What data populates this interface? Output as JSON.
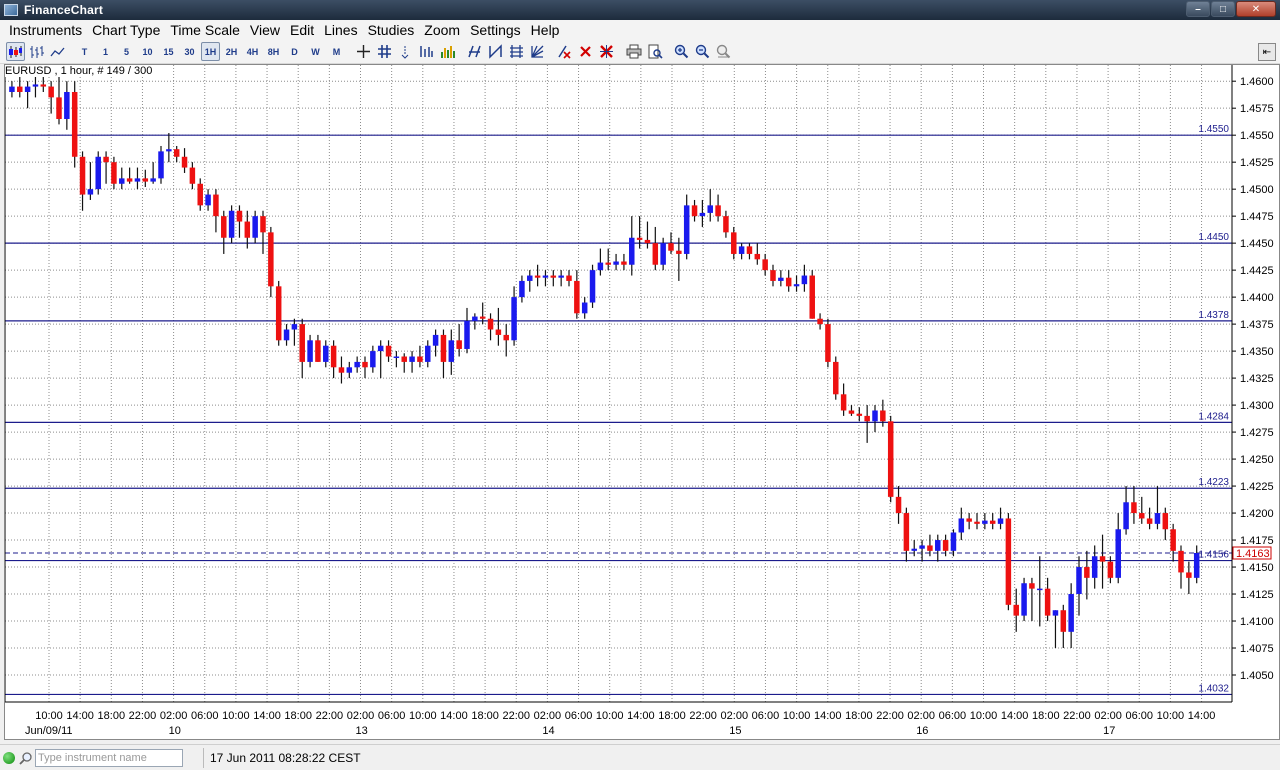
{
  "window": {
    "title": "FinanceChart",
    "min": "0",
    "max": "1",
    "close": "r"
  },
  "menu": [
    "Instruments",
    "Chart Type",
    "Time Scale",
    "View",
    "Edit",
    "Lines",
    "Studies",
    "Zoom",
    "Settings",
    "Help"
  ],
  "toolbar": {
    "timeframes": [
      "T",
      "1",
      "5",
      "10",
      "15",
      "30",
      "1H",
      "2H",
      "4H",
      "8H",
      "D",
      "W",
      "M"
    ],
    "active_timeframe": "1H"
  },
  "chart": {
    "instrument_info": "EURUSD , 1 hour, # 149 / 300",
    "ylim": [
      1.4025,
      1.4615
    ],
    "y_ticks": [
      "1.4600",
      "1.4575",
      "1.4550",
      "1.4525",
      "1.4500",
      "1.4475",
      "1.4450",
      "1.4425",
      "1.4400",
      "1.4375",
      "1.4350",
      "1.4325",
      "1.4300",
      "1.4275",
      "1.4250",
      "1.4225",
      "1.4200",
      "1.4175",
      "1.4150",
      "1.4125",
      "1.4100",
      "1.4075",
      "1.4050"
    ],
    "horizontal_lines": [
      "1.4550",
      "1.4450",
      "1.4378",
      "1.4284",
      "1.4223",
      "1.4156",
      "1.4032"
    ],
    "current_price": "1.4163",
    "x_ticks": [
      "10:00",
      "14:00",
      "18:00",
      "22:00",
      "02:00",
      "06:00",
      "10:00",
      "14:00",
      "18:00",
      "22:00",
      "02:00",
      "06:00",
      "10:00",
      "14:00",
      "18:00",
      "22:00",
      "02:00",
      "06:00",
      "10:00",
      "14:00",
      "18:00",
      "22:00",
      "02:00",
      "06:00",
      "10:00",
      "14:00",
      "18:00",
      "22:00",
      "02:00",
      "06:00",
      "10:00",
      "14:00",
      "18:00",
      "22:00",
      "02:00",
      "06:00",
      "10:00",
      "14:00"
    ],
    "date_labels": [
      "Jun/09/11",
      "10",
      "13",
      "14",
      "15",
      "16",
      "17"
    ],
    "colors": {
      "up": "#1a1aee",
      "down": "#ee1111",
      "level_line": "#1c1c8c",
      "price_box": "#cc0000"
    }
  },
  "chart_data": {
    "type": "candlestick",
    "ohlc": [
      [
        1.459,
        1.46,
        1.4585,
        1.4595
      ],
      [
        1.4595,
        1.4605,
        1.4585,
        1.459
      ],
      [
        1.459,
        1.46,
        1.4575,
        1.4595
      ],
      [
        1.4595,
        1.4605,
        1.4585,
        1.4597
      ],
      [
        1.4597,
        1.4605,
        1.459,
        1.4595
      ],
      [
        1.4595,
        1.46,
        1.457,
        1.4585
      ],
      [
        1.4585,
        1.4605,
        1.456,
        1.4565
      ],
      [
        1.4565,
        1.46,
        1.4555,
        1.459
      ],
      [
        1.459,
        1.46,
        1.452,
        1.453
      ],
      [
        1.453,
        1.4535,
        1.448,
        1.4495
      ],
      [
        1.4495,
        1.4525,
        1.449,
        1.45
      ],
      [
        1.45,
        1.4535,
        1.4495,
        1.453
      ],
      [
        1.453,
        1.4535,
        1.4505,
        1.4525
      ],
      [
        1.4525,
        1.453,
        1.45,
        1.4505
      ],
      [
        1.4505,
        1.452,
        1.45,
        1.451
      ],
      [
        1.451,
        1.452,
        1.4505,
        1.4507
      ],
      [
        1.4507,
        1.452,
        1.45,
        1.451
      ],
      [
        1.451,
        1.4518,
        1.4502,
        1.4507
      ],
      [
        1.4507,
        1.4525,
        1.4505,
        1.451
      ],
      [
        1.451,
        1.454,
        1.4505,
        1.4535
      ],
      [
        1.4535,
        1.4552,
        1.4525,
        1.4537
      ],
      [
        1.4537,
        1.454,
        1.4525,
        1.453
      ],
      [
        1.453,
        1.4538,
        1.4515,
        1.452
      ],
      [
        1.452,
        1.4525,
        1.45,
        1.4505
      ],
      [
        1.4505,
        1.451,
        1.448,
        1.4485
      ],
      [
        1.4485,
        1.45,
        1.448,
        1.4495
      ],
      [
        1.4495,
        1.45,
        1.446,
        1.4475
      ],
      [
        1.4475,
        1.448,
        1.444,
        1.4455
      ],
      [
        1.4455,
        1.4485,
        1.445,
        1.448
      ],
      [
        1.448,
        1.4485,
        1.4455,
        1.447
      ],
      [
        1.447,
        1.448,
        1.4445,
        1.4455
      ],
      [
        1.4455,
        1.448,
        1.445,
        1.4475
      ],
      [
        1.4475,
        1.448,
        1.444,
        1.446
      ],
      [
        1.446,
        1.4465,
        1.44,
        1.441
      ],
      [
        1.441,
        1.4415,
        1.4355,
        1.436
      ],
      [
        1.436,
        1.4375,
        1.4355,
        1.437
      ],
      [
        1.437,
        1.438,
        1.4355,
        1.4375
      ],
      [
        1.4375,
        1.438,
        1.4325,
        1.434
      ],
      [
        1.434,
        1.4365,
        1.4335,
        1.436
      ],
      [
        1.436,
        1.4365,
        1.434,
        1.434
      ],
      [
        1.434,
        1.436,
        1.4335,
        1.4355
      ],
      [
        1.4355,
        1.436,
        1.4325,
        1.4335
      ],
      [
        1.4335,
        1.4345,
        1.432,
        1.433
      ],
      [
        1.433,
        1.434,
        1.4325,
        1.4335
      ],
      [
        1.4335,
        1.4345,
        1.433,
        1.434
      ],
      [
        1.434,
        1.4345,
        1.4325,
        1.4335
      ],
      [
        1.4335,
        1.4355,
        1.433,
        1.435
      ],
      [
        1.435,
        1.436,
        1.4325,
        1.4355
      ],
      [
        1.4355,
        1.436,
        1.434,
        1.4345
      ],
      [
        1.4345,
        1.435,
        1.4335,
        1.4345
      ],
      [
        1.4345,
        1.4348,
        1.433,
        1.434
      ],
      [
        1.434,
        1.435,
        1.433,
        1.4345
      ],
      [
        1.4345,
        1.4355,
        1.4335,
        1.434
      ],
      [
        1.434,
        1.436,
        1.4335,
        1.4355
      ],
      [
        1.4355,
        1.437,
        1.4345,
        1.4365
      ],
      [
        1.4365,
        1.437,
        1.4325,
        1.434
      ],
      [
        1.434,
        1.437,
        1.4328,
        1.436
      ],
      [
        1.436,
        1.4375,
        1.4345,
        1.4352
      ],
      [
        1.4352,
        1.439,
        1.4348,
        1.4378
      ],
      [
        1.4378,
        1.4385,
        1.437,
        1.4382
      ],
      [
        1.4382,
        1.4395,
        1.4375,
        1.438
      ],
      [
        1.438,
        1.4385,
        1.436,
        1.437
      ],
      [
        1.437,
        1.439,
        1.4355,
        1.4365
      ],
      [
        1.4365,
        1.4375,
        1.4345,
        1.436
      ],
      [
        1.436,
        1.441,
        1.4355,
        1.44
      ],
      [
        1.44,
        1.442,
        1.4395,
        1.4415
      ],
      [
        1.4415,
        1.4425,
        1.4405,
        1.442
      ],
      [
        1.442,
        1.443,
        1.441,
        1.4418
      ],
      [
        1.4418,
        1.4425,
        1.441,
        1.442
      ],
      [
        1.442,
        1.4425,
        1.441,
        1.4418
      ],
      [
        1.4418,
        1.4425,
        1.441,
        1.442
      ],
      [
        1.442,
        1.4425,
        1.441,
        1.4415
      ],
      [
        1.4415,
        1.4425,
        1.438,
        1.4385
      ],
      [
        1.4385,
        1.44,
        1.438,
        1.4395
      ],
      [
        1.4395,
        1.443,
        1.439,
        1.4425
      ],
      [
        1.4425,
        1.4445,
        1.442,
        1.4432
      ],
      [
        1.4432,
        1.4445,
        1.4425,
        1.443
      ],
      [
        1.443,
        1.444,
        1.4425,
        1.4433
      ],
      [
        1.4433,
        1.444,
        1.4425,
        1.443
      ],
      [
        1.443,
        1.4475,
        1.442,
        1.4455
      ],
      [
        1.4455,
        1.4475,
        1.4445,
        1.4453
      ],
      [
        1.4453,
        1.447,
        1.4445,
        1.445
      ],
      [
        1.445,
        1.4465,
        1.4425,
        1.443
      ],
      [
        1.443,
        1.4455,
        1.4425,
        1.445
      ],
      [
        1.445,
        1.446,
        1.444,
        1.4443
      ],
      [
        1.4443,
        1.4455,
        1.4415,
        1.444
      ],
      [
        1.444,
        1.4495,
        1.4435,
        1.4485
      ],
      [
        1.4485,
        1.449,
        1.447,
        1.4475
      ],
      [
        1.4475,
        1.449,
        1.4465,
        1.4478
      ],
      [
        1.4478,
        1.45,
        1.447,
        1.4485
      ],
      [
        1.4485,
        1.4495,
        1.447,
        1.4475
      ],
      [
        1.4475,
        1.448,
        1.4455,
        1.446
      ],
      [
        1.446,
        1.4465,
        1.4435,
        1.444
      ],
      [
        1.444,
        1.445,
        1.4435,
        1.4447
      ],
      [
        1.4447,
        1.445,
        1.4435,
        1.444
      ],
      [
        1.444,
        1.445,
        1.443,
        1.4435
      ],
      [
        1.4435,
        1.444,
        1.442,
        1.4425
      ],
      [
        1.4425,
        1.443,
        1.441,
        1.4415
      ],
      [
        1.4415,
        1.4425,
        1.441,
        1.4418
      ],
      [
        1.4418,
        1.4425,
        1.4405,
        1.441
      ],
      [
        1.441,
        1.442,
        1.4405,
        1.4412
      ],
      [
        1.4412,
        1.443,
        1.4405,
        1.442
      ],
      [
        1.442,
        1.4425,
        1.438,
        1.438
      ],
      [
        1.438,
        1.4385,
        1.437,
        1.4375
      ],
      [
        1.4375,
        1.438,
        1.4335,
        1.434
      ],
      [
        1.434,
        1.4345,
        1.4305,
        1.431
      ],
      [
        1.431,
        1.432,
        1.429,
        1.4295
      ],
      [
        1.4295,
        1.43,
        1.429,
        1.4292
      ],
      [
        1.4292,
        1.4298,
        1.4285,
        1.429
      ],
      [
        1.429,
        1.43,
        1.4265,
        1.4285
      ],
      [
        1.4285,
        1.43,
        1.4275,
        1.4295
      ],
      [
        1.4295,
        1.4305,
        1.428,
        1.4285
      ],
      [
        1.4285,
        1.429,
        1.421,
        1.4215
      ],
      [
        1.4215,
        1.4225,
        1.419,
        1.42
      ],
      [
        1.42,
        1.4205,
        1.4155,
        1.4165
      ],
      [
        1.4165,
        1.4175,
        1.416,
        1.4167
      ],
      [
        1.4167,
        1.4175,
        1.4155,
        1.417
      ],
      [
        1.417,
        1.418,
        1.416,
        1.4165
      ],
      [
        1.4165,
        1.418,
        1.4155,
        1.4175
      ],
      [
        1.4175,
        1.418,
        1.416,
        1.4165
      ],
      [
        1.4165,
        1.4185,
        1.416,
        1.4182
      ],
      [
        1.4182,
        1.4205,
        1.4175,
        1.4195
      ],
      [
        1.4195,
        1.42,
        1.4185,
        1.4192
      ],
      [
        1.4192,
        1.42,
        1.4185,
        1.419
      ],
      [
        1.419,
        1.42,
        1.4185,
        1.4193
      ],
      [
        1.4193,
        1.42,
        1.4185,
        1.419
      ],
      [
        1.419,
        1.4205,
        1.4185,
        1.4195
      ],
      [
        1.4195,
        1.42,
        1.411,
        1.4115
      ],
      [
        1.4115,
        1.413,
        1.409,
        1.4105
      ],
      [
        1.4105,
        1.414,
        1.41,
        1.4135
      ],
      [
        1.4135,
        1.414,
        1.41,
        1.413
      ],
      [
        1.413,
        1.416,
        1.4095,
        1.413
      ],
      [
        1.413,
        1.414,
        1.41,
        1.4105
      ],
      [
        1.4105,
        1.411,
        1.4075,
        1.411
      ],
      [
        1.411,
        1.4115,
        1.4075,
        1.409
      ],
      [
        1.409,
        1.4135,
        1.4075,
        1.4125
      ],
      [
        1.4125,
        1.416,
        1.4105,
        1.415
      ],
      [
        1.415,
        1.4165,
        1.412,
        1.414
      ],
      [
        1.414,
        1.417,
        1.413,
        1.416
      ],
      [
        1.416,
        1.418,
        1.413,
        1.4155
      ],
      [
        1.4155,
        1.416,
        1.4135,
        1.414
      ],
      [
        1.414,
        1.42,
        1.4135,
        1.4185
      ],
      [
        1.4185,
        1.4225,
        1.418,
        1.421
      ],
      [
        1.421,
        1.4225,
        1.419,
        1.42
      ],
      [
        1.42,
        1.4215,
        1.419,
        1.4195
      ],
      [
        1.4195,
        1.4205,
        1.4185,
        1.419
      ],
      [
        1.419,
        1.4225,
        1.4185,
        1.42
      ],
      [
        1.42,
        1.4205,
        1.4175,
        1.4185
      ],
      [
        1.4185,
        1.419,
        1.4155,
        1.4165
      ],
      [
        1.4165,
        1.417,
        1.413,
        1.4145
      ],
      [
        1.4145,
        1.4155,
        1.4125,
        1.414
      ],
      [
        1.414,
        1.417,
        1.4135,
        1.4163
      ]
    ]
  },
  "statusbar": {
    "instrument_placeholder": "Type instrument name",
    "datetime": "17 Jun 2011 08:28:22 CEST"
  }
}
